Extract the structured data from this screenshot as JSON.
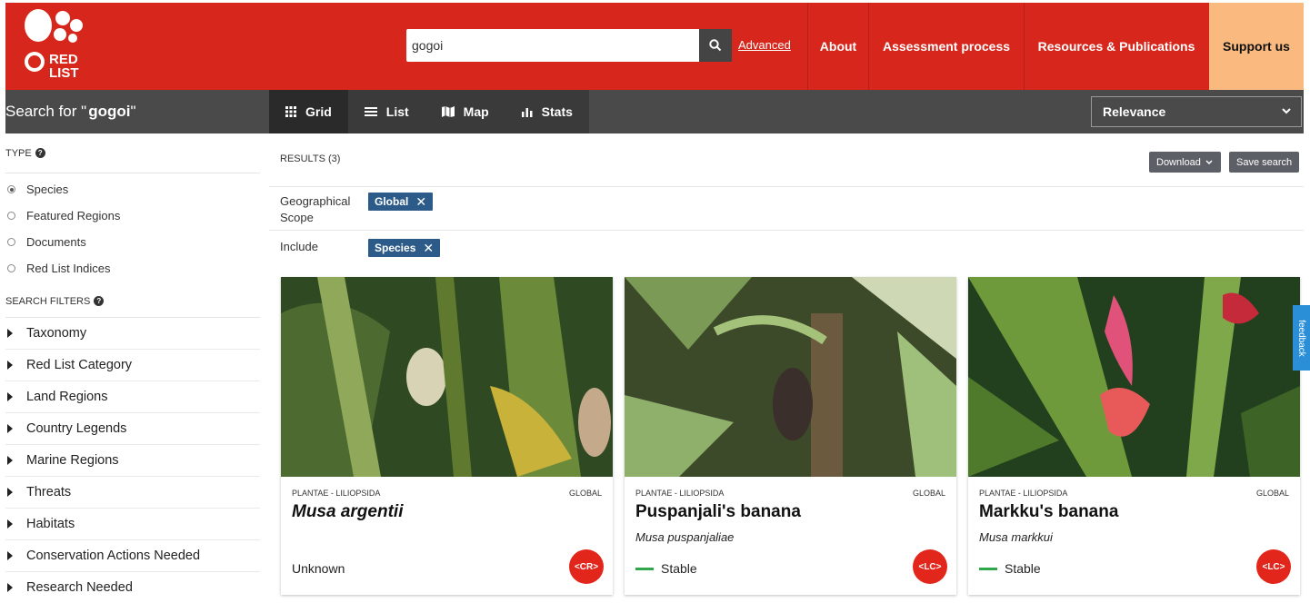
{
  "header": {
    "logo_text": [
      "RED",
      "LIST"
    ],
    "search_value": "gogoi",
    "advanced_label": "Advanced",
    "nav": [
      "About",
      "Assessment process",
      "Resources & Publications"
    ],
    "support_label": "Support us"
  },
  "toolbar": {
    "search_for_prefix": "Search for \"",
    "search_for_query": "gogoi",
    "search_for_suffix": "\"",
    "tabs": [
      "Grid",
      "List",
      "Map",
      "Stats"
    ],
    "sort_label": "Relevance"
  },
  "sidebar": {
    "type_heading": "TYPE",
    "types": [
      "Species",
      "Featured Regions",
      "Documents",
      "Red List Indices"
    ],
    "filters_heading": "SEARCH FILTERS",
    "filters": [
      "Taxonomy",
      "Red List Category",
      "Land Regions",
      "Country Legends",
      "Marine Regions",
      "Threats",
      "Habitats",
      "Conservation Actions Needed",
      "Research Needed"
    ]
  },
  "results": {
    "count_label": "RESULTS (3)",
    "download_label": "Download",
    "save_label": "Save search",
    "scope_label_1": "Geographical",
    "scope_label_2": "Scope",
    "scope_chip": "Global",
    "include_label": "Include",
    "include_chip": "Species"
  },
  "cards": [
    {
      "meta": "PLANTAE - LILIOPSIDA",
      "scope": "GLOBAL",
      "title": "Musa argentii",
      "sci": "",
      "trend": "Unknown",
      "category": "CR"
    },
    {
      "meta": "PLANTAE - LILIOPSIDA",
      "scope": "GLOBAL",
      "title": "Puspanjali's banana",
      "sci": "Musa puspanjaliae",
      "trend": "Stable",
      "category": "LC"
    },
    {
      "meta": "PLANTAE - LILIOPSIDA",
      "scope": "GLOBAL",
      "title": "Markku's banana",
      "sci": "Musa markkui",
      "trend": "Stable",
      "category": "LC"
    }
  ],
  "feedback_label": "feedback",
  "colors": {
    "brand_red": "#d7261c",
    "support_bg": "#f9b97f",
    "chip_blue": "#2c5b8a",
    "trend_green": "#2ea84a"
  }
}
